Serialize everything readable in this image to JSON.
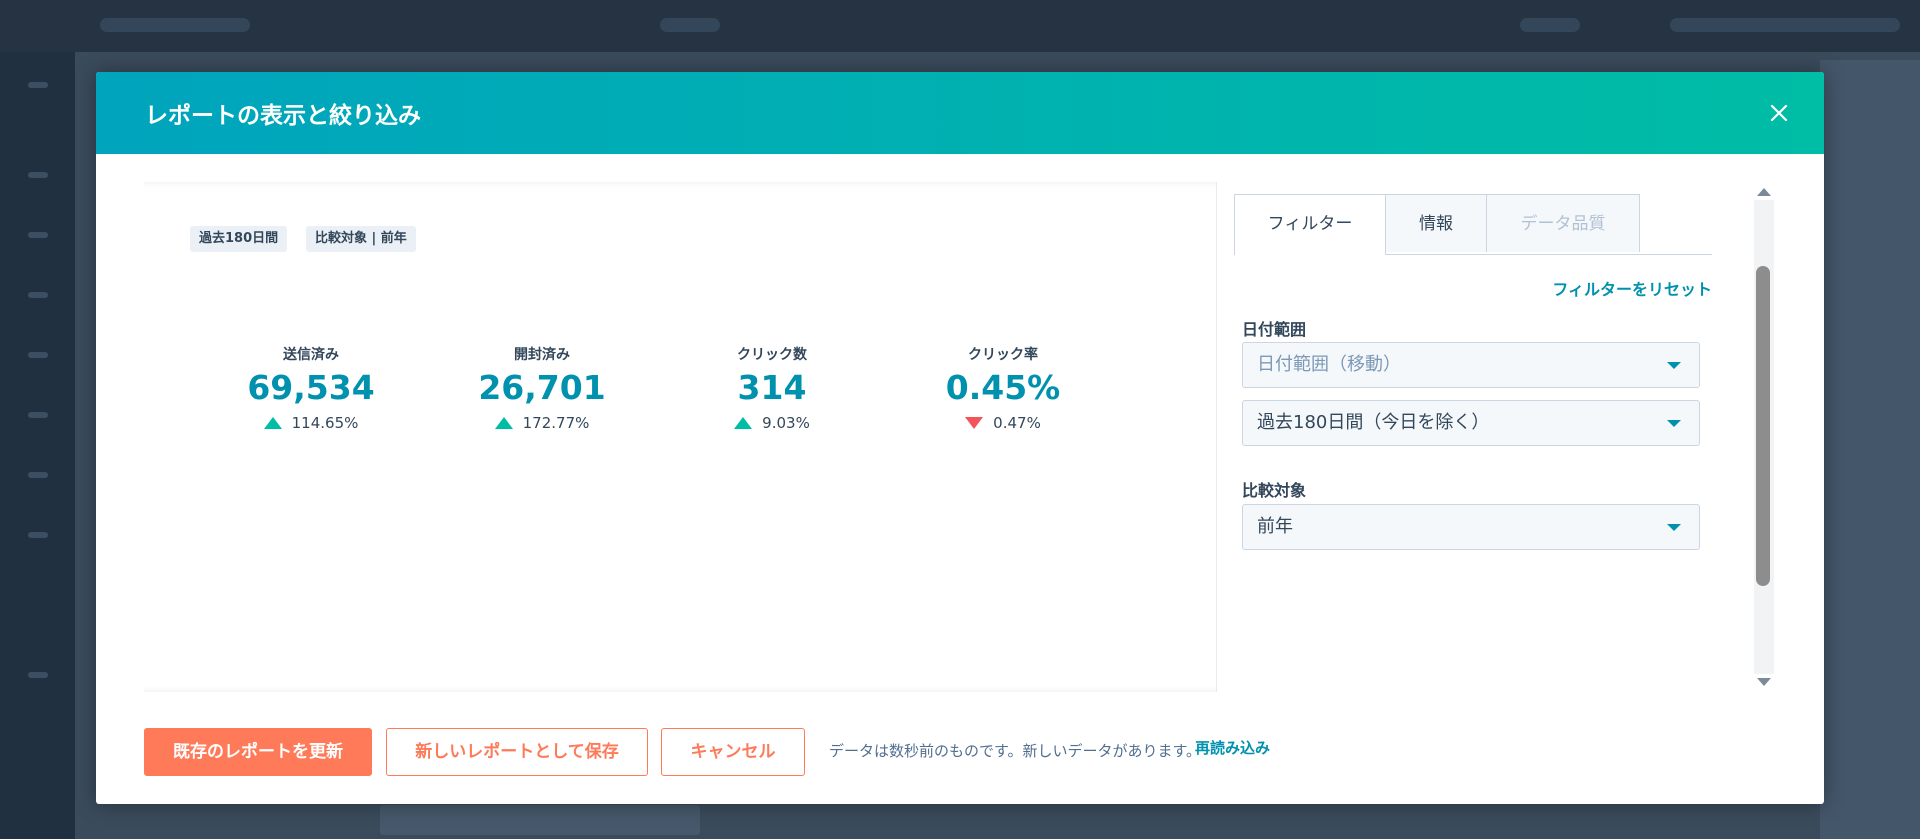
{
  "modal": {
    "title": "レポートの表示と絞り込み"
  },
  "report": {
    "tags": [
      "過去180日間",
      "比較対象 | 前年"
    ],
    "kpis": [
      {
        "label": "送信済み",
        "value": "69,534",
        "change": "114.65%",
        "direction": "up"
      },
      {
        "label": "開封済み",
        "value": "26,701",
        "change": "172.77%",
        "direction": "up"
      },
      {
        "label": "クリック数",
        "value": "314",
        "change": "9.03%",
        "direction": "up"
      },
      {
        "label": "クリック率",
        "value": "0.45%",
        "change": "0.47%",
        "direction": "down"
      }
    ]
  },
  "filters": {
    "tabs": [
      {
        "label": "フィルター",
        "state": "active"
      },
      {
        "label": "情報",
        "state": "normal"
      },
      {
        "label": "データ品質",
        "state": "disabled"
      }
    ],
    "reset_label": "フィルターをリセット",
    "date_range_label": "日付範囲",
    "date_range_type": "日付範囲（移動）",
    "date_range_value": "過去180日間（今日を除く）",
    "compare_label": "比較対象",
    "compare_value": "前年"
  },
  "footer": {
    "update_label": "既存のレポートを更新",
    "save_new_label": "新しいレポートとして保存",
    "cancel_label": "キャンセル",
    "note": "データは数秒前のものです。新しいデータがあります。",
    "reload_label": "再読み込み"
  },
  "colors": {
    "header_gradient_start": "#00a4bd",
    "header_gradient_end": "#00bda5",
    "kpi_value": "#0091ae",
    "up": "#00bda5",
    "down": "#f2545b",
    "primary_button": "#ff7a59"
  }
}
